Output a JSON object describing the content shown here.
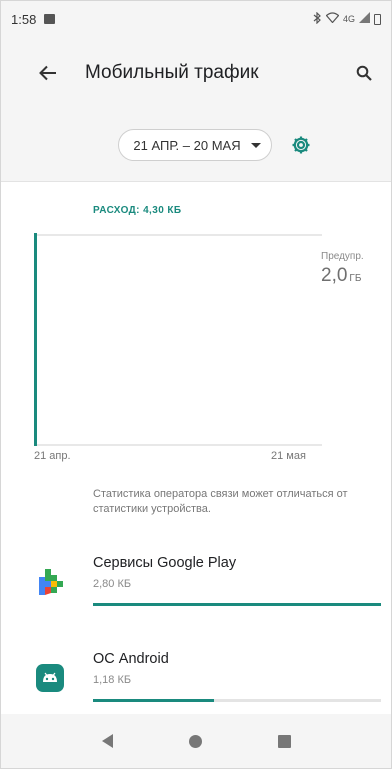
{
  "status_bar": {
    "time": "1:58",
    "network": "4G"
  },
  "app_bar": {
    "title": "Мобильный трафик"
  },
  "date_range": {
    "label": "21 АПР. – 20 МАЯ"
  },
  "usage": {
    "label": "РАСХОД: 4,30 КБ",
    "limit_caption": "Предупр.",
    "limit_value": "2,0",
    "limit_unit": "ГБ",
    "axis_start": "21 апр.",
    "axis_end": "21 мая",
    "note": "Статистика оператора связи может отличаться от статистики устройства."
  },
  "apps": [
    {
      "name": "Сервисы Google Play",
      "size": "2,80 КБ",
      "share": 1.0
    },
    {
      "name": "ОС Android",
      "size": "1,18 КБ",
      "share": 0.42
    }
  ],
  "colors": {
    "accent": "#1a8a7e",
    "background": "#f5f5f5"
  },
  "icons": {
    "back": "arrow-back-icon",
    "search": "search-icon",
    "settings": "gear-icon"
  }
}
